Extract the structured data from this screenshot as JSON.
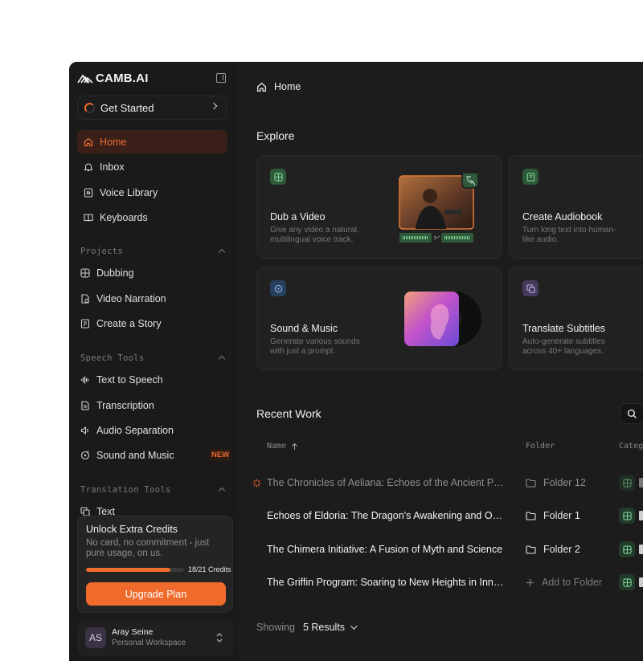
{
  "app": {
    "brand": "CAMB.AI"
  },
  "sidebar": {
    "get_started": "Get Started",
    "main_items": [
      {
        "label": "Home",
        "icon": "home-icon",
        "active": true
      },
      {
        "label": "Inbox",
        "icon": "bell-icon"
      },
      {
        "label": "Voice Library",
        "icon": "voice-library-icon"
      },
      {
        "label": "Keyboards",
        "icon": "book-icon"
      }
    ],
    "projects": {
      "label": "Projects",
      "items": [
        {
          "label": "Dubbing",
          "icon": "dubbing-icon"
        },
        {
          "label": "Video Narration",
          "icon": "video-narration-icon"
        },
        {
          "label": "Create a Story",
          "icon": "story-icon"
        }
      ]
    },
    "speech_tools": {
      "label": "Speech Tools",
      "items": [
        {
          "label": "Text to Speech",
          "icon": "waveform-icon"
        },
        {
          "label": "Transcription",
          "icon": "document-icon"
        },
        {
          "label": "Audio Separation",
          "icon": "speaker-icon"
        },
        {
          "label": "Sound and Music",
          "icon": "music-icon",
          "badge": "NEW"
        }
      ]
    },
    "translation_tools": {
      "label": "Translation Tools",
      "items": [
        {
          "label": "Text",
          "icon": "translate-icon"
        }
      ]
    },
    "credits": {
      "title": "Unlock Extra Credits",
      "description": "No card, no commitment - just pure usage, on us.",
      "used": 18,
      "total": 21,
      "progress_label": "18/21 Credits",
      "upgrade_label": "Upgrade Plan"
    },
    "user": {
      "initials": "AS",
      "name": "Aray Seine",
      "workspace": "Personal Workspace"
    }
  },
  "main": {
    "breadcrumb": "Home",
    "explore_title": "Explore",
    "explore_cards": [
      {
        "title": "Dub a Video",
        "description": "Give any video a natural, multilingual voice track.",
        "icon": "dub-icon",
        "color": "#2f5a3a"
      },
      {
        "title": "Create Audiobook",
        "description": "Turn long text into human-like audio.",
        "icon": "audiobook-icon",
        "color": "#2f5a3a"
      },
      {
        "title": "Sound & Music",
        "description": "Generate various sounds with just a prompt.",
        "icon": "sound-icon",
        "color": "#27405e"
      },
      {
        "title": "Translate Subtitles",
        "description": "Auto-generate subtitles across 40+ languages.",
        "icon": "subtitles-icon",
        "color": "#463a5c"
      }
    ],
    "recent_title": "Recent Work",
    "columns": {
      "name": "Name",
      "folder": "Folder",
      "category": "Categ"
    },
    "rows": [
      {
        "name": "The Chronicles of Aeliana: Echoes of the Ancient Prophecy",
        "folder": "Folder 12",
        "processing": true
      },
      {
        "name": "Echoes of Eldoria: The Dragon's Awakening and Other Tales",
        "folder": "Folder 1",
        "processing": false
      },
      {
        "name": "The Chimera Initiative: A Fusion of Myth and Science",
        "folder": "Folder 2",
        "processing": false
      },
      {
        "name": "The Griffin Program: Soaring to New Heights in Innovation",
        "folder": "Add to Folder",
        "processing": false,
        "no_folder": true
      }
    ],
    "showing_label": "Showing",
    "results_label": "5 Results"
  },
  "colors": {
    "accent": "#f06a2c",
    "background": "#1c1c1c",
    "sidebar": "#1a1a1a"
  }
}
